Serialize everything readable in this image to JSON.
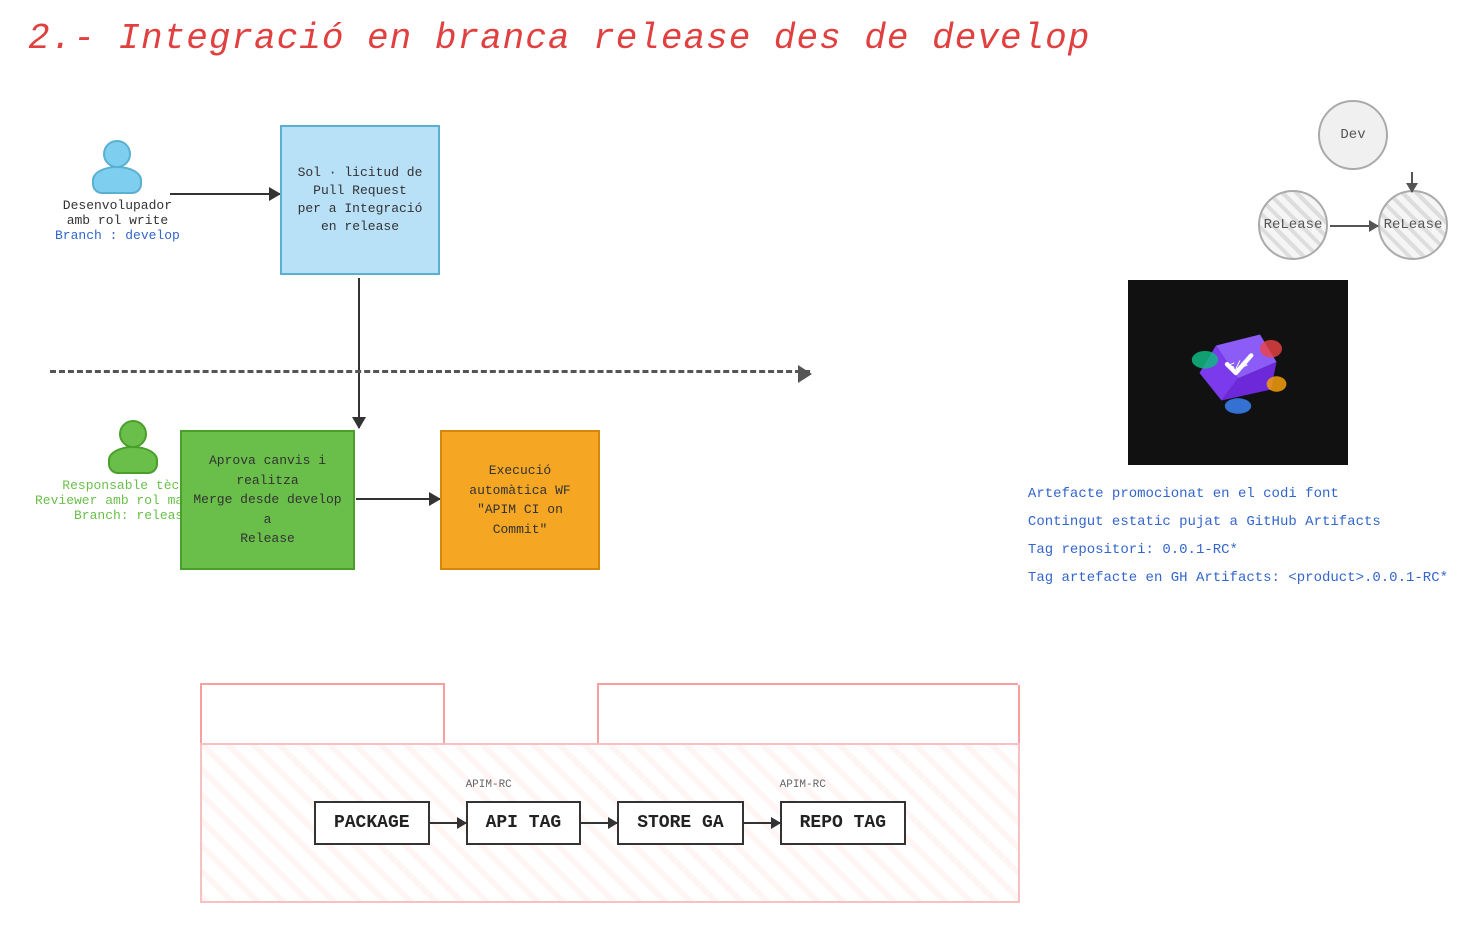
{
  "title": "2.- Integració en branca release des de develop",
  "developer": {
    "label": "Desenvolupador",
    "role": "amb rol write",
    "branch": "Branch : develop"
  },
  "pullrequest": {
    "text": "Sol · licitud de\nPull Request\nper a Integració\nen release"
  },
  "responsible": {
    "label": "Responsable tècnic",
    "role": "Reviewer amb rol maintain",
    "branch": "Branch: release"
  },
  "merge": {
    "text": "Aprova canvis i realitza\nMerge desde develop a\nRelease"
  },
  "execution": {
    "text": "Execució\nautomàtica WF\n\"APIM CI on\nCommit\""
  },
  "git_branches": {
    "dev": "Dev",
    "release_left": "ReLease",
    "release_right": "ReLease"
  },
  "info": {
    "line1": "Artefacte promocionat en el codi font",
    "line2": "Contingut estatic pujat a GitHub Artifacts",
    "line3": "Tag repositori: 0.0.1-RC*",
    "line4": "Tag artefacte en GH Artifacts: <product>.0.0.1-RC*"
  },
  "workflow": {
    "apim_label_left": "APIM-RC",
    "apim_label_right": "APIM-RC",
    "steps": [
      "PACKAGE",
      "API TAG",
      "STORE GA",
      "REPO TAG"
    ]
  }
}
